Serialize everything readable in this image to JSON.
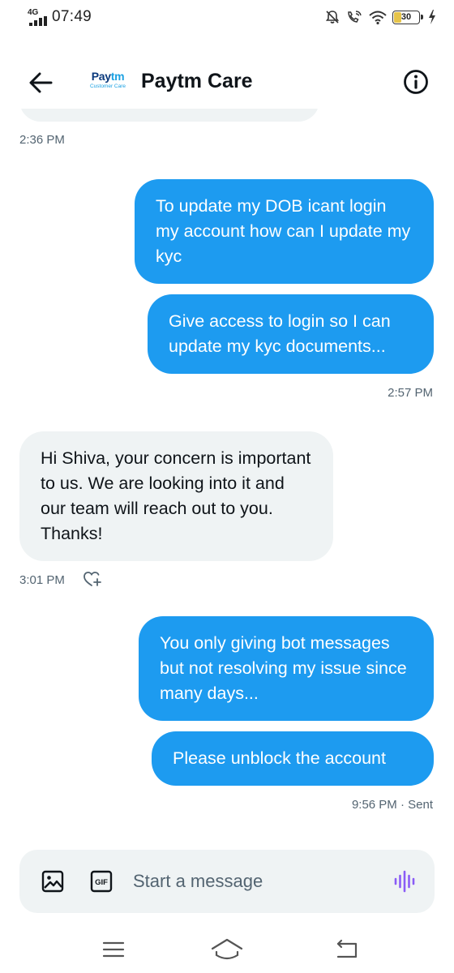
{
  "status_bar": {
    "network": "4G",
    "time": "07:49",
    "battery": "30",
    "battery_level_percent": 30
  },
  "header": {
    "logo": {
      "brand_part1": "Pay",
      "brand_part2": "tm",
      "subtitle": "Customer Care"
    },
    "title": "Paytm Care",
    "back_icon": "arrow-left-icon",
    "info_icon": "info-circle-icon"
  },
  "messages": [
    {
      "type": "timestamp",
      "text": "2:36 PM"
    },
    {
      "type": "outgoing",
      "text": "To update my DOB icant login my account how can I update my kyc"
    },
    {
      "type": "outgoing",
      "text": "Give access to login so I can update my kyc documents..."
    },
    {
      "type": "timestamp",
      "text": "2:57 PM"
    },
    {
      "type": "incoming",
      "text": "Hi Shiva, your concern is important to us. We are looking into it and our team will reach out to you. Thanks!"
    },
    {
      "type": "timestamp",
      "text": "3:01 PM"
    },
    {
      "type": "outgoing",
      "text": "You only giving bot messages but not resolving my issue since many days..."
    },
    {
      "type": "outgoing",
      "text": "Please unblock the account"
    },
    {
      "type": "timestamp",
      "text": "9:56 PM · Sent"
    }
  ],
  "composer": {
    "placeholder": "Start a message",
    "gif_label": "GIF",
    "icons": [
      "image-icon",
      "gif-icon",
      "voice-waveform-icon"
    ]
  },
  "nav_bar": {
    "icons": [
      "menu-icon",
      "home-icon",
      "back-icon"
    ]
  },
  "colors": {
    "outgoing_bubble": "#1d9bf0",
    "incoming_bubble": "#eff3f4",
    "timestamp": "#536471",
    "voice_icon": "#8a5cf6",
    "battery_fill": "#e6c44a"
  }
}
